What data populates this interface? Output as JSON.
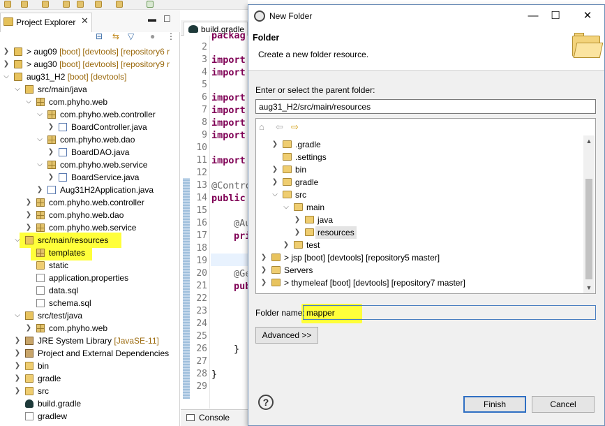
{
  "project_explorer": {
    "tab_label": "Project Explorer",
    "tree": [
      {
        "label": "> aug09",
        "deco": "[boot] [devtools] [repository6 r"
      },
      {
        "label": "> aug30",
        "deco": "[boot] [devtools] [repository9 r"
      },
      {
        "label": "aug31_H2",
        "deco": "[boot] [devtools]"
      },
      {
        "label": "src/main/java",
        "deco": ""
      },
      {
        "label": "com.phyho.web",
        "deco": ""
      },
      {
        "label": "com.phyho.web.controller",
        "deco": ""
      },
      {
        "label": "BoardController.java",
        "deco": ""
      },
      {
        "label": "com.phyho.web.dao",
        "deco": ""
      },
      {
        "label": "BoardDAO.java",
        "deco": ""
      },
      {
        "label": "com.phyho.web.service",
        "deco": ""
      },
      {
        "label": "BoardService.java",
        "deco": ""
      },
      {
        "label": "Aug31H2Application.java",
        "deco": ""
      },
      {
        "label": "com.phyho.web.controller",
        "deco": ""
      },
      {
        "label": "com.phyho.web.dao",
        "deco": ""
      },
      {
        "label": "com.phyho.web.service",
        "deco": ""
      },
      {
        "label": "src/main/resources",
        "deco": ""
      },
      {
        "label": "templates",
        "deco": ""
      },
      {
        "label": "static",
        "deco": ""
      },
      {
        "label": "application.properties",
        "deco": ""
      },
      {
        "label": "data.sql",
        "deco": ""
      },
      {
        "label": "schema.sql",
        "deco": ""
      },
      {
        "label": "src/test/java",
        "deco": ""
      },
      {
        "label": "com.phyho.web",
        "deco": ""
      },
      {
        "label": "JRE System Library",
        "deco": "[JavaSE-11]"
      },
      {
        "label": "Project and External Dependencies",
        "deco": ""
      },
      {
        "label": "bin",
        "deco": ""
      },
      {
        "label": "gradle",
        "deco": ""
      },
      {
        "label": "src",
        "deco": ""
      },
      {
        "label": "build.gradle",
        "deco": ""
      },
      {
        "label": "gradlew",
        "deco": ""
      }
    ]
  },
  "editor": {
    "tab_label": "build.gradle",
    "line_numbers": [
      "2",
      "3",
      "4",
      "5",
      "6",
      "7",
      "8",
      "9",
      "10",
      "11",
      "12",
      "13",
      "14",
      "15",
      "16",
      "17",
      "18",
      "19",
      "20",
      "21",
      "22",
      "23",
      "24",
      "25",
      "26",
      "27",
      "28",
      "29"
    ],
    "code": {
      "l1": "packag",
      "l3": "import",
      "l4": "import",
      "l6": "import",
      "l7": "import",
      "l8": "import",
      "l9": "import",
      "l11": "import",
      "l13": "@Contro",
      "l14": "public",
      "l16": "@Au",
      "l17": "pri",
      "l20": "@Ge",
      "l21": "pub",
      "l26": "}",
      "l28": "}"
    },
    "console_label": "Console"
  },
  "dialog": {
    "title": "New Folder",
    "heading": "Folder",
    "description": "Create a new folder resource.",
    "parent_label": "Enter or select the parent folder:",
    "parent_value": "aug31_H2/src/main/resources",
    "tree": [
      {
        "label": ".gradle"
      },
      {
        "label": ".settings"
      },
      {
        "label": "bin"
      },
      {
        "label": "gradle"
      },
      {
        "label": "src"
      },
      {
        "label": "main"
      },
      {
        "label": "java"
      },
      {
        "label": "resources"
      },
      {
        "label": "test"
      },
      {
        "label": "> jsp [boot] [devtools] [repository5 master]"
      },
      {
        "label": "Servers"
      },
      {
        "label": "> thymeleaf [boot] [devtools] [repository7 master]"
      }
    ],
    "folder_name_label": "Folder name:",
    "folder_name_value": "mapper",
    "advanced_label": "Advanced >>",
    "help_label": "?",
    "finish_label": "Finish",
    "cancel_label": "Cancel",
    "minimize_label": "—",
    "maximize_label": "☐",
    "close_label": "✕"
  }
}
